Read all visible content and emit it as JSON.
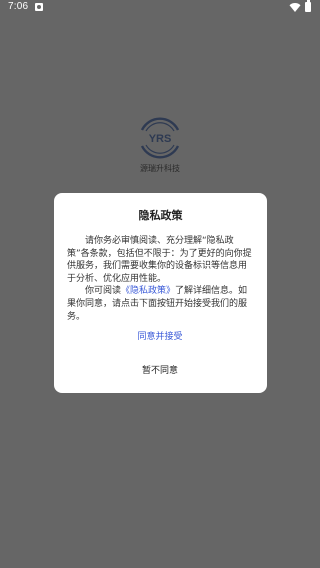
{
  "status_bar": {
    "time": "7:06",
    "icons": [
      "notification-icon",
      "wifi-icon",
      "battery-icon"
    ]
  },
  "app": {
    "logo_text": "YRS",
    "name": "源瑞升科技"
  },
  "dialog": {
    "title": "隐私政策",
    "para1": "请你务必审慎阅读、充分理解“隐私政策”各条款，包括但不限于：为了更好的向你提供服务，我们需要收集你的设备标识等信息用于分析、优化应用性能。",
    "para2_prefix": "你可阅读",
    "para2_link": "《隐私政策》",
    "para2_suffix": "了解详细信息。如果你同意，请点击下面按钮开始接受我们的服务。",
    "agree_label": "同意并接受",
    "disagree_label": "暂不同意"
  },
  "colors": {
    "overlay": "#666666",
    "link": "#3a5ad8",
    "dialog_bg": "#ffffff"
  }
}
